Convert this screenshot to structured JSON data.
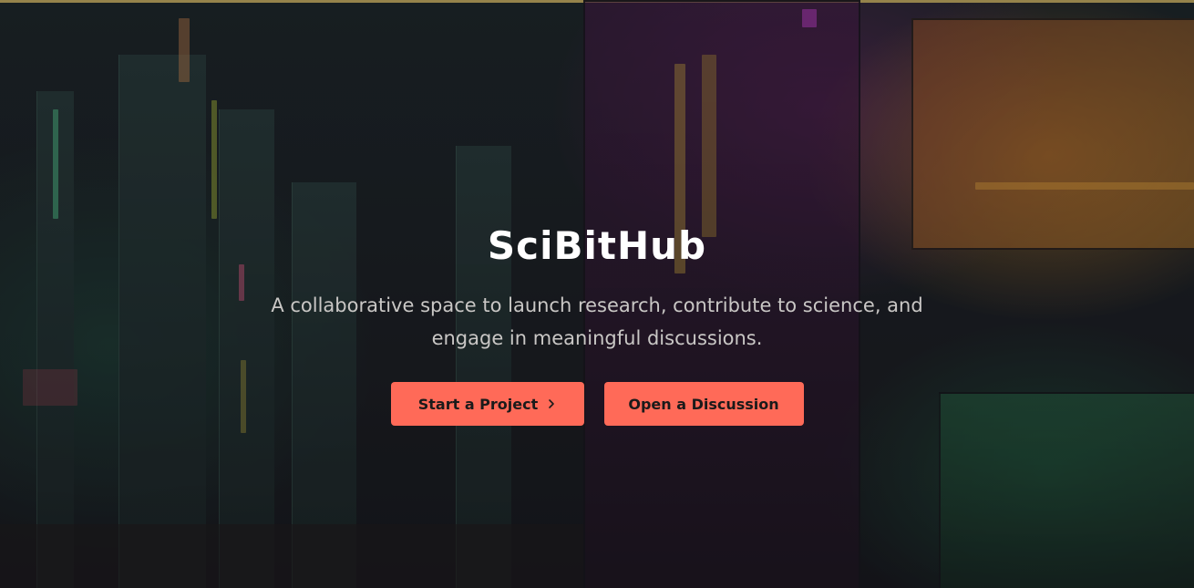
{
  "hero": {
    "title": "SciBitHub",
    "subtitle": "A collaborative space to launch research, contribute to science, and engage in meaningful discussions.",
    "primary_button_label": "Start a Project",
    "secondary_button_label": "Open a Discussion",
    "primary_button_icon": "chevron-right-icon"
  },
  "colors": {
    "accent": "#ff6a58",
    "top_border": "#c9b060",
    "title": "#ffffff",
    "subtitle": "#c9c7c5"
  }
}
